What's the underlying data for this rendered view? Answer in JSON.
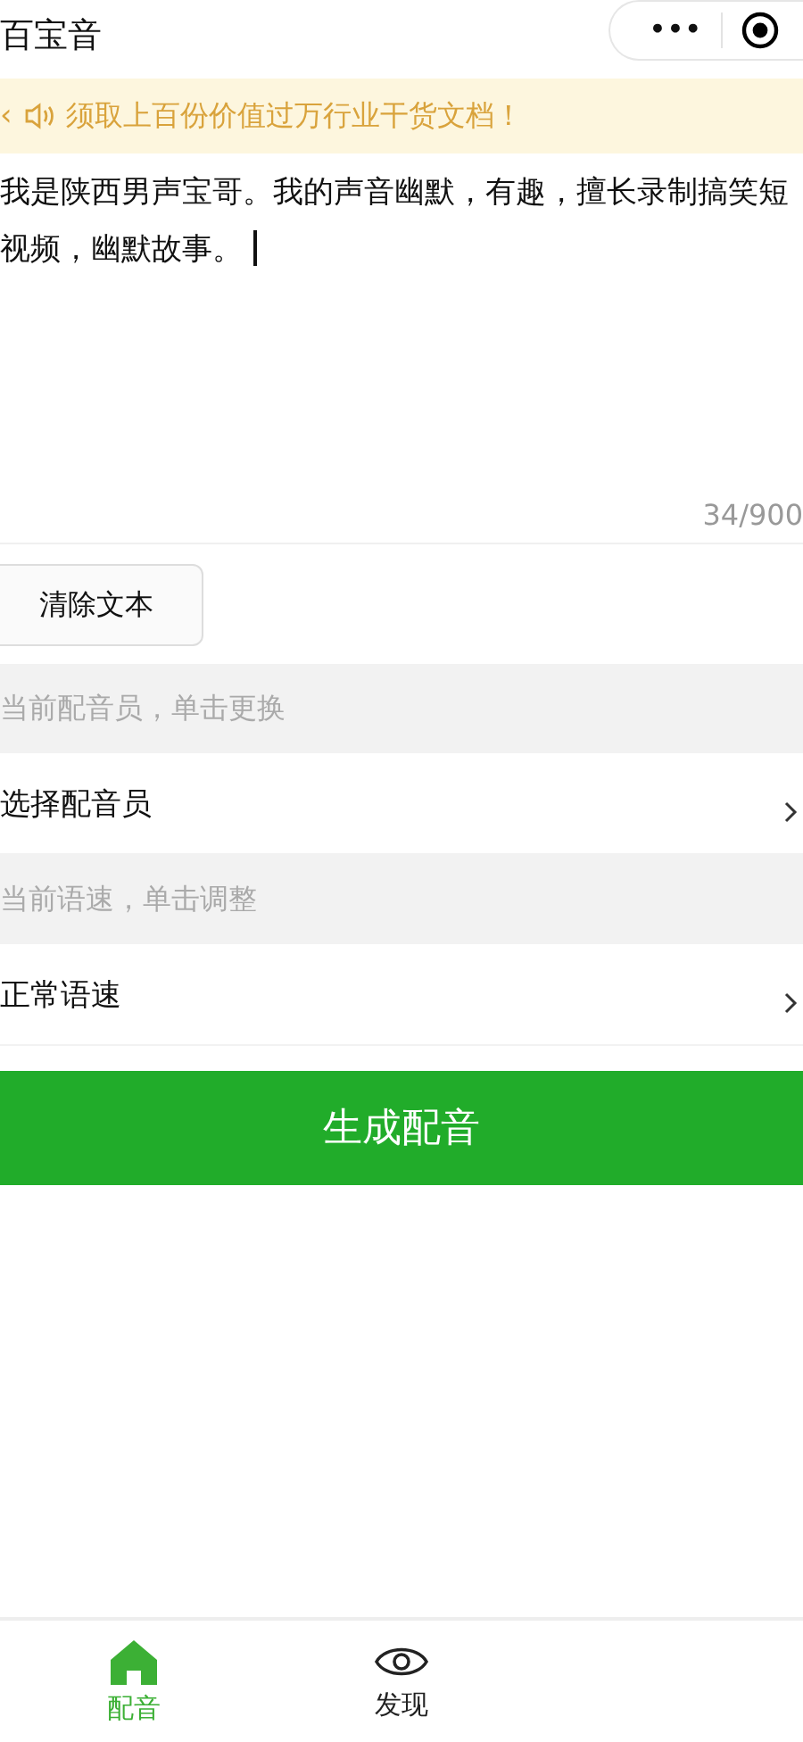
{
  "nav_bar": {
    "title": "百宝音",
    "more": "•••"
  },
  "notice": {
    "arrow": "‹",
    "text": "须取上百份价值过万行业干货文档！"
  },
  "editor": {
    "value": "我是陕西男声宝哥。我的声音幽默，有趣，擅长录制搞笑短视频，幽默故事。",
    "counter": "34/900"
  },
  "clear_button": "清除文本",
  "settings": [
    {
      "hint": "当前配音员，单击更换",
      "value": "选择配音员"
    },
    {
      "hint": "当前语速，单击调整",
      "value": "正常语速"
    }
  ],
  "generate_button": "生成配音",
  "tabs": [
    {
      "label": "配音",
      "selected": true
    },
    {
      "label": "发现",
      "selected": false
    }
  ]
}
